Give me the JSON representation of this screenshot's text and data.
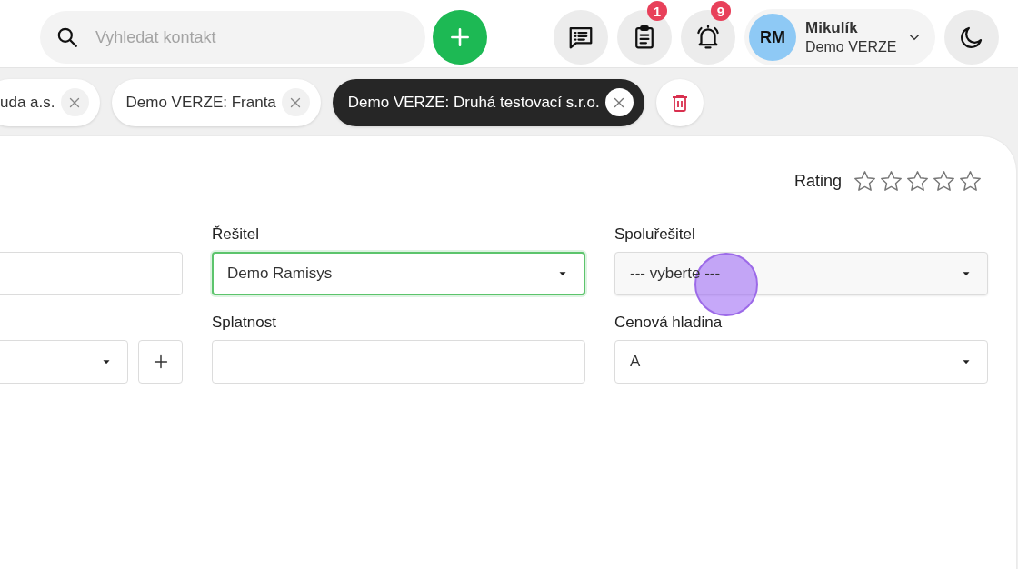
{
  "search": {
    "placeholder": "Vyhledat kontakt"
  },
  "toolbar": [
    {
      "kind": "messages"
    },
    {
      "kind": "tasks",
      "badge": "1"
    },
    {
      "kind": "notifications",
      "badge": "9"
    }
  ],
  "user": {
    "initials": "RM",
    "name": "Mikulík",
    "company": "Demo VERZE"
  },
  "tabs": [
    {
      "label": "uda a.s.",
      "selected": false
    },
    {
      "label": "Demo VERZE: Franta",
      "selected": false
    },
    {
      "label": "Demo VERZE: Druhá testovací s.r.o.",
      "selected": true
    }
  ],
  "rating": {
    "label": "Rating",
    "stars": 0
  },
  "fields": [
    {
      "kind": "text",
      "focused": false
    },
    {
      "kind": "select",
      "label": "Řešitel",
      "value": "Demo Ramisys",
      "focused": true
    },
    {
      "kind": "select",
      "label": "Spoluřešitel",
      "value": "--- vyberte ---",
      "focused": false
    },
    {
      "kind": "select_add",
      "focused": false
    },
    {
      "kind": "text",
      "label": "Splatnost",
      "focused": false
    },
    {
      "kind": "select",
      "label": "Cenová hladina",
      "value": "A",
      "focused": false
    }
  ]
}
